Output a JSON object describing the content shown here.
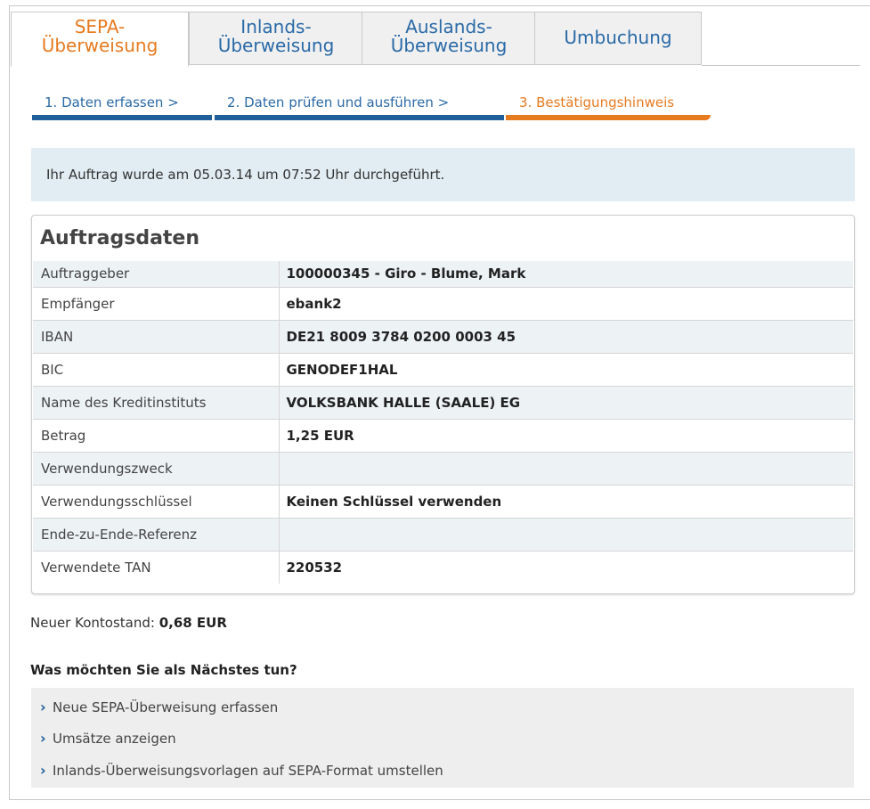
{
  "tabs": [
    {
      "line1": "SEPA-",
      "line2": "Überweisung",
      "active": true
    },
    {
      "line1": "Inlands-",
      "line2": "Überweisung",
      "active": false
    },
    {
      "line1": "Auslands-",
      "line2": "Überweisung",
      "active": false
    },
    {
      "line1": "Umbuchung",
      "line2": "",
      "active": false
    }
  ],
  "steps": [
    {
      "label": "1. Daten erfassen  >"
    },
    {
      "label": "2. Daten prüfen und ausführen  >"
    },
    {
      "label": "3. Bestätigungshinweis"
    }
  ],
  "notice": "Ihr Auftrag wurde am 05.03.14 um 07:52 Uhr durchgeführt.",
  "panel": {
    "title": "Auftragsdaten",
    "rows": [
      {
        "label": "Auftraggeber",
        "value": "100000345 - Giro - Blume, Mark"
      },
      {
        "label": "Empfänger",
        "value": "ebank2"
      },
      {
        "label": "IBAN",
        "value": "DE21 8009 3784 0200 0003 45"
      },
      {
        "label": "BIC",
        "value": "GENODEF1HAL"
      },
      {
        "label": "Name des Kreditinstituts",
        "value": "VOLKSBANK HALLE (SAALE) EG"
      },
      {
        "label": "Betrag",
        "value": "1,25 EUR"
      },
      {
        "label": "Verwendungszweck",
        "value": ""
      },
      {
        "label": "Verwendungsschlüssel",
        "value": "Keinen Schlüssel verwenden"
      },
      {
        "label": "Ende-zu-Ende-Referenz",
        "value": ""
      },
      {
        "label": "Verwendete TAN",
        "value": "220532"
      }
    ]
  },
  "balance": {
    "label": "Neuer Kontostand:",
    "value": "0,68 EUR"
  },
  "next": {
    "heading": "Was möchten Sie als Nächstes tun?",
    "actions": [
      {
        "label": "Neue SEPA-Überweisung erfassen",
        "icon": "chevron-right-icon"
      },
      {
        "label": "Umsätze anzeigen",
        "icon": "chevron-right-icon"
      },
      {
        "label": "Inlands-Überweisungsvorlagen auf SEPA-Format umstellen",
        "icon": "chevron-right-icon"
      }
    ]
  },
  "colors": {
    "accent": "#e67a1f",
    "primary": "#215f9a",
    "link": "#2a6aa7",
    "notice_bg": "#e1ecf3"
  }
}
